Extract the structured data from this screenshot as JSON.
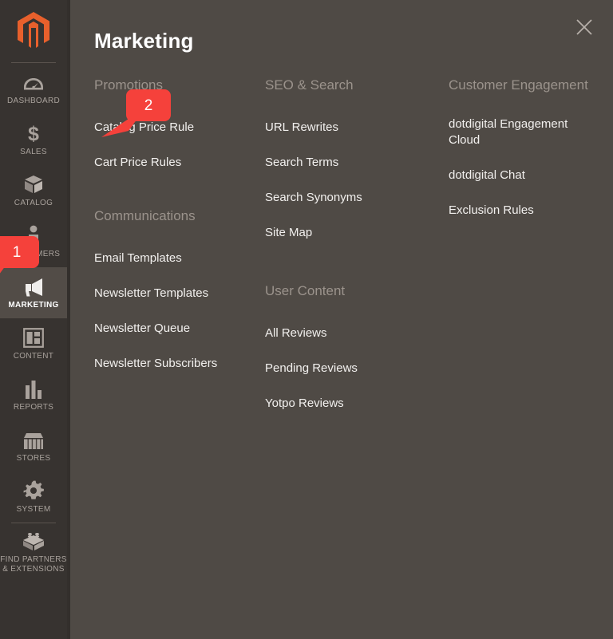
{
  "sidebar": {
    "logo": {
      "icon": "magento-logo-icon",
      "color": "#e8602c"
    },
    "items": [
      {
        "label": "DASHBOARD",
        "icon": "gauge-icon",
        "active": false
      },
      {
        "label": "SALES",
        "icon": "dollar-icon",
        "active": false
      },
      {
        "label": "CATALOG",
        "icon": "box-icon",
        "active": false
      },
      {
        "label": "CUSTOMERS",
        "icon": "person-icon",
        "active": false
      },
      {
        "label": "MARKETING",
        "icon": "megaphone-icon",
        "active": true
      },
      {
        "label": "CONTENT",
        "icon": "layout-icon",
        "active": false
      },
      {
        "label": "REPORTS",
        "icon": "bar-chart-icon",
        "active": false
      },
      {
        "label": "STORES",
        "icon": "storefront-icon",
        "active": false
      },
      {
        "label": "SYSTEM",
        "icon": "gear-icon",
        "active": false
      },
      {
        "label": "FIND PARTNERS\n& EXTENSIONS",
        "icon": "lego-brick-icon",
        "active": false
      }
    ]
  },
  "panel": {
    "title": "Marketing",
    "close_icon": "close-icon",
    "columns": [
      {
        "groups": [
          {
            "heading": "Promotions",
            "links": [
              "Catalog Price Rule",
              "Cart Price Rules"
            ]
          },
          {
            "heading": "Communications",
            "links": [
              "Email Templates",
              "Newsletter Templates",
              "Newsletter Queue",
              "Newsletter Subscribers"
            ]
          }
        ]
      },
      {
        "groups": [
          {
            "heading": "SEO & Search",
            "links": [
              "URL Rewrites",
              "Search Terms",
              "Search Synonyms",
              "Site Map"
            ]
          },
          {
            "heading": "User Content",
            "links": [
              "All Reviews",
              "Pending Reviews",
              "Yotpo Reviews"
            ]
          }
        ]
      },
      {
        "groups": [
          {
            "heading": "Customer Engagement",
            "links": [
              "dotdigital Engagement Cloud",
              "dotdigital Chat",
              "Exclusion Rules"
            ]
          }
        ]
      }
    ]
  },
  "callouts": [
    {
      "number": "1",
      "color": "#f5413b",
      "points_to": "sidebar-item-marketing"
    },
    {
      "number": "2",
      "color": "#f5413b",
      "points_to": "menu-link-catalog-price-rule"
    }
  ],
  "colors": {
    "sidebar_bg": "#373330",
    "panel_bg": "#4f4a45",
    "active_item_bg": "#524c47",
    "heading_text": "#9b938c",
    "link_text": "#f2f0ee",
    "accent": "#e8602c",
    "callout": "#f5413b"
  }
}
